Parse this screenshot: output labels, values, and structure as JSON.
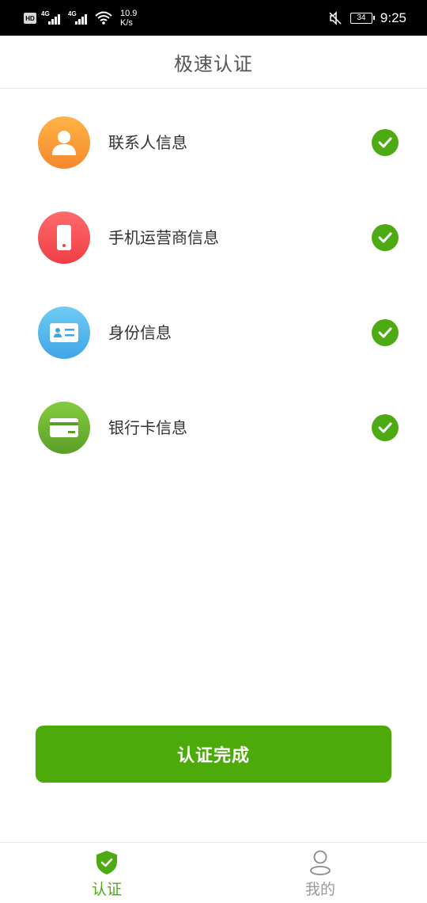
{
  "status_bar": {
    "hd_badge": "HD",
    "net1": "4G",
    "net2": "4G",
    "speed_value": "10.9",
    "speed_unit": "K/s",
    "battery": "34",
    "time": "9:25"
  },
  "header": {
    "title": "极速认证"
  },
  "verification_items": [
    {
      "label": "联系人信息",
      "icon": "person-icon",
      "color": "#f5892c",
      "verified": true
    },
    {
      "label": "手机运营商信息",
      "icon": "phone-icon",
      "color": "#ee3e45",
      "verified": true
    },
    {
      "label": "身份信息",
      "icon": "id-card-icon",
      "color": "#3fa5e6",
      "verified": true
    },
    {
      "label": "银行卡信息",
      "icon": "bank-card-icon",
      "color": "#5a9e28",
      "verified": true
    }
  ],
  "action": {
    "button_label": "认证完成"
  },
  "tab_bar": {
    "tabs": [
      {
        "label": "认证",
        "icon": "shield-check-icon",
        "active": true
      },
      {
        "label": "我的",
        "icon": "user-outline-icon",
        "active": false
      }
    ]
  },
  "colors": {
    "accent": "#4caa12",
    "button": "#4caa0a",
    "inactive": "#9a9a9a"
  }
}
